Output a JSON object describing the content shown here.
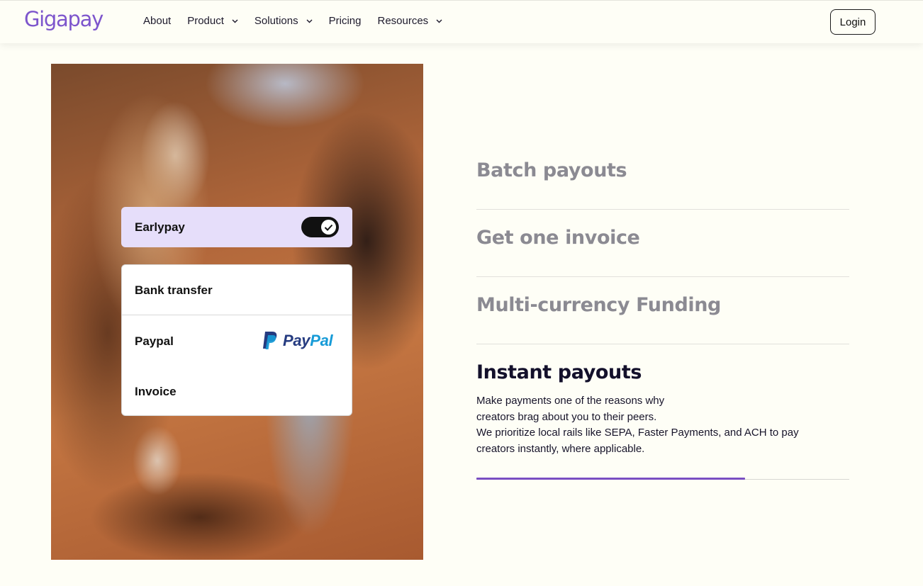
{
  "header": {
    "logo": "Gigapay",
    "nav": [
      {
        "label": "About",
        "has_dropdown": false
      },
      {
        "label": "Product",
        "has_dropdown": true
      },
      {
        "label": "Solutions",
        "has_dropdown": true
      },
      {
        "label": "Pricing",
        "has_dropdown": false
      },
      {
        "label": "Resources",
        "has_dropdown": true
      }
    ],
    "login_label": "Login"
  },
  "visual": {
    "earlypay_label": "Earlypay",
    "earlypay_toggle_on": true,
    "methods": {
      "bank_transfer": "Bank transfer",
      "paypal": "Paypal",
      "invoice": "Invoice"
    },
    "paypal_logo_text": "PayPal"
  },
  "features": {
    "items": [
      {
        "title": "Batch payouts"
      },
      {
        "title": "Get one invoice"
      },
      {
        "title": "Multi-currency Funding"
      },
      {
        "title": "Instant payouts"
      }
    ],
    "active_body": {
      "line1": "Make payments one of the reasons why",
      "line2": "creators brag about you to their peers.",
      "line3": "We prioritize local rails like SEPA, Faster Payments, and ACH to pay",
      "line4": "creators instantly, where applicable."
    },
    "active_progress": 0.72
  },
  "colors": {
    "brand": "#7d55cc",
    "background": "#fefef6",
    "inactive_title": "#8b8a92",
    "active_title": "#13102b",
    "earlypay_card": "#e6defa",
    "progress": "#7a4fc2"
  }
}
